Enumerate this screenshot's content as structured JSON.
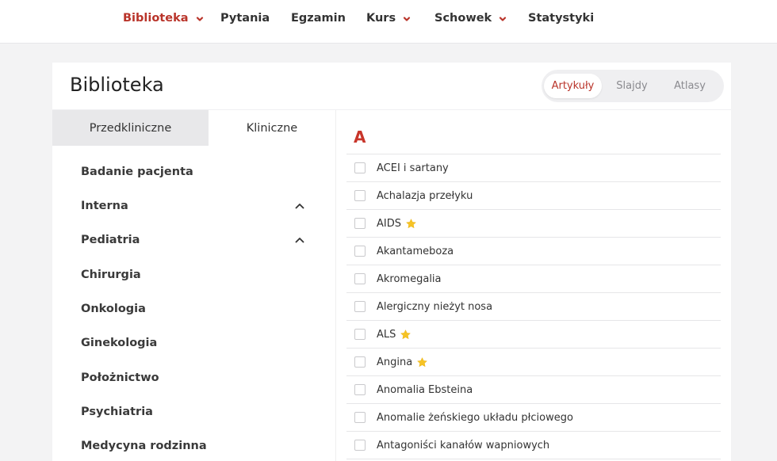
{
  "nav": {
    "items": [
      {
        "label": "Biblioteka",
        "active": true,
        "dropdown": true
      },
      {
        "label": "Pytania",
        "active": false,
        "dropdown": false
      },
      {
        "label": "Egzamin",
        "active": false,
        "dropdown": false
      },
      {
        "label": "Kurs",
        "active": false,
        "dropdown": true
      },
      {
        "label": "Schowek",
        "active": false,
        "dropdown": true
      },
      {
        "label": "Statystyki",
        "active": false,
        "dropdown": false
      }
    ]
  },
  "page": {
    "title": "Biblioteka",
    "view_switch": [
      {
        "label": "Artykuły",
        "active": true
      },
      {
        "label": "Slajdy",
        "active": false
      },
      {
        "label": "Atlasy",
        "active": false
      }
    ]
  },
  "sidebar": {
    "tabs": [
      {
        "label": "Przedkliniczne",
        "active": true
      },
      {
        "label": "Kliniczne",
        "active": false
      }
    ],
    "categories": [
      {
        "label": "Badanie pacjenta",
        "expandable": false
      },
      {
        "label": "Interna",
        "expandable": true
      },
      {
        "label": "Pediatria",
        "expandable": true
      },
      {
        "label": "Chirurgia",
        "expandable": false
      },
      {
        "label": "Onkologia",
        "expandable": false
      },
      {
        "label": "Ginekologia",
        "expandable": false
      },
      {
        "label": "Położnictwo",
        "expandable": false
      },
      {
        "label": "Psychiatria",
        "expandable": false
      },
      {
        "label": "Medycyna rodzinna",
        "expandable": false
      }
    ]
  },
  "articles": {
    "letter": "A",
    "items": [
      {
        "label": "ACEI i sartany",
        "starred": false,
        "checked": false
      },
      {
        "label": "Achalazja przełyku",
        "starred": false,
        "checked": false
      },
      {
        "label": "AIDS",
        "starred": true,
        "checked": false
      },
      {
        "label": "Akantameboza",
        "starred": false,
        "checked": false
      },
      {
        "label": "Akromegalia",
        "starred": false,
        "checked": false
      },
      {
        "label": "Alergiczny nieżyt nosa",
        "starred": false,
        "checked": false
      },
      {
        "label": "ALS",
        "starred": true,
        "checked": false
      },
      {
        "label": "Angina",
        "starred": true,
        "checked": false
      },
      {
        "label": "Anomalia Ebsteina",
        "starred": false,
        "checked": false
      },
      {
        "label": "Anomalie żeńskiego układu płciowego",
        "starred": false,
        "checked": false
      },
      {
        "label": "Antagoniści kanałów wapniowych",
        "starred": false,
        "checked": false
      }
    ]
  },
  "colors": {
    "accent": "#b9342a",
    "letter": "#c8352a",
    "star": "#f6c324",
    "background": "#f3f3f4"
  },
  "icons": {
    "dropdown": "chevron-down-icon",
    "expand": "chevron-up-icon",
    "favorite": "star-icon"
  }
}
